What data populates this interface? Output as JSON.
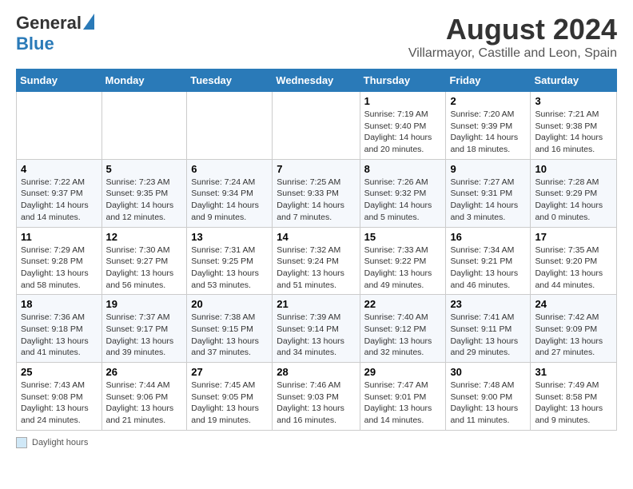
{
  "logo": {
    "general": "General",
    "blue": "Blue"
  },
  "title": "August 2024",
  "subtitle": "Villarmayor, Castille and Leon, Spain",
  "days_of_week": [
    "Sunday",
    "Monday",
    "Tuesday",
    "Wednesday",
    "Thursday",
    "Friday",
    "Saturday"
  ],
  "footer_label": "Daylight hours",
  "weeks": [
    [
      {
        "day": "",
        "info": ""
      },
      {
        "day": "",
        "info": ""
      },
      {
        "day": "",
        "info": ""
      },
      {
        "day": "",
        "info": ""
      },
      {
        "day": "1",
        "info": "Sunrise: 7:19 AM\nSunset: 9:40 PM\nDaylight: 14 hours and 20 minutes."
      },
      {
        "day": "2",
        "info": "Sunrise: 7:20 AM\nSunset: 9:39 PM\nDaylight: 14 hours and 18 minutes."
      },
      {
        "day": "3",
        "info": "Sunrise: 7:21 AM\nSunset: 9:38 PM\nDaylight: 14 hours and 16 minutes."
      }
    ],
    [
      {
        "day": "4",
        "info": "Sunrise: 7:22 AM\nSunset: 9:37 PM\nDaylight: 14 hours and 14 minutes."
      },
      {
        "day": "5",
        "info": "Sunrise: 7:23 AM\nSunset: 9:35 PM\nDaylight: 14 hours and 12 minutes."
      },
      {
        "day": "6",
        "info": "Sunrise: 7:24 AM\nSunset: 9:34 PM\nDaylight: 14 hours and 9 minutes."
      },
      {
        "day": "7",
        "info": "Sunrise: 7:25 AM\nSunset: 9:33 PM\nDaylight: 14 hours and 7 minutes."
      },
      {
        "day": "8",
        "info": "Sunrise: 7:26 AM\nSunset: 9:32 PM\nDaylight: 14 hours and 5 minutes."
      },
      {
        "day": "9",
        "info": "Sunrise: 7:27 AM\nSunset: 9:31 PM\nDaylight: 14 hours and 3 minutes."
      },
      {
        "day": "10",
        "info": "Sunrise: 7:28 AM\nSunset: 9:29 PM\nDaylight: 14 hours and 0 minutes."
      }
    ],
    [
      {
        "day": "11",
        "info": "Sunrise: 7:29 AM\nSunset: 9:28 PM\nDaylight: 13 hours and 58 minutes."
      },
      {
        "day": "12",
        "info": "Sunrise: 7:30 AM\nSunset: 9:27 PM\nDaylight: 13 hours and 56 minutes."
      },
      {
        "day": "13",
        "info": "Sunrise: 7:31 AM\nSunset: 9:25 PM\nDaylight: 13 hours and 53 minutes."
      },
      {
        "day": "14",
        "info": "Sunrise: 7:32 AM\nSunset: 9:24 PM\nDaylight: 13 hours and 51 minutes."
      },
      {
        "day": "15",
        "info": "Sunrise: 7:33 AM\nSunset: 9:22 PM\nDaylight: 13 hours and 49 minutes."
      },
      {
        "day": "16",
        "info": "Sunrise: 7:34 AM\nSunset: 9:21 PM\nDaylight: 13 hours and 46 minutes."
      },
      {
        "day": "17",
        "info": "Sunrise: 7:35 AM\nSunset: 9:20 PM\nDaylight: 13 hours and 44 minutes."
      }
    ],
    [
      {
        "day": "18",
        "info": "Sunrise: 7:36 AM\nSunset: 9:18 PM\nDaylight: 13 hours and 41 minutes."
      },
      {
        "day": "19",
        "info": "Sunrise: 7:37 AM\nSunset: 9:17 PM\nDaylight: 13 hours and 39 minutes."
      },
      {
        "day": "20",
        "info": "Sunrise: 7:38 AM\nSunset: 9:15 PM\nDaylight: 13 hours and 37 minutes."
      },
      {
        "day": "21",
        "info": "Sunrise: 7:39 AM\nSunset: 9:14 PM\nDaylight: 13 hours and 34 minutes."
      },
      {
        "day": "22",
        "info": "Sunrise: 7:40 AM\nSunset: 9:12 PM\nDaylight: 13 hours and 32 minutes."
      },
      {
        "day": "23",
        "info": "Sunrise: 7:41 AM\nSunset: 9:11 PM\nDaylight: 13 hours and 29 minutes."
      },
      {
        "day": "24",
        "info": "Sunrise: 7:42 AM\nSunset: 9:09 PM\nDaylight: 13 hours and 27 minutes."
      }
    ],
    [
      {
        "day": "25",
        "info": "Sunrise: 7:43 AM\nSunset: 9:08 PM\nDaylight: 13 hours and 24 minutes."
      },
      {
        "day": "26",
        "info": "Sunrise: 7:44 AM\nSunset: 9:06 PM\nDaylight: 13 hours and 21 minutes."
      },
      {
        "day": "27",
        "info": "Sunrise: 7:45 AM\nSunset: 9:05 PM\nDaylight: 13 hours and 19 minutes."
      },
      {
        "day": "28",
        "info": "Sunrise: 7:46 AM\nSunset: 9:03 PM\nDaylight: 13 hours and 16 minutes."
      },
      {
        "day": "29",
        "info": "Sunrise: 7:47 AM\nSunset: 9:01 PM\nDaylight: 13 hours and 14 minutes."
      },
      {
        "day": "30",
        "info": "Sunrise: 7:48 AM\nSunset: 9:00 PM\nDaylight: 13 hours and 11 minutes."
      },
      {
        "day": "31",
        "info": "Sunrise: 7:49 AM\nSunset: 8:58 PM\nDaylight: 13 hours and 9 minutes."
      }
    ]
  ]
}
